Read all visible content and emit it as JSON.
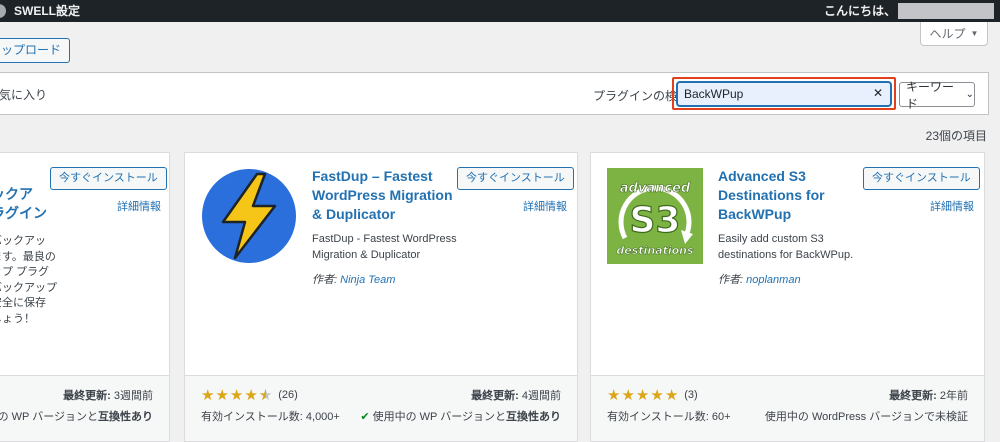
{
  "admin_bar": {
    "site_name": "SWELL設定",
    "greeting": "こんにちは、"
  },
  "help": {
    "label": "ヘルプ"
  },
  "upload": {
    "label": "ップロード"
  },
  "filter": {
    "tab_favorites": "気に入り",
    "search_label": "プラグインの検索",
    "search_value": "BackWPup",
    "search_type": "キーワード"
  },
  "results": {
    "count": "23個の項目"
  },
  "cards": [
    {
      "title_lines": [
        "ックア",
        "ラグイン"
      ],
      "install_label": "今すぐインストール",
      "more_label": "詳細情報",
      "desc_lines": [
        "バックアッ",
        "ます。最良の",
        "ップ プラグ",
        "バックアップ",
        "安全に保存",
        "しょう！"
      ],
      "updated_label": "最終更新:",
      "updated_value": "3週間前",
      "compat_prefix": "用中の WP バージョンと",
      "compat_bold": "互換性あり"
    },
    {
      "title": "FastDup – Fastest WordPress Migration & Duplicator",
      "install_label": "今すぐインストール",
      "more_label": "詳細情報",
      "description": "FastDup - Fastest WordPress Migration & Duplicator",
      "author_label": "作者:",
      "author_name": "Ninja Team",
      "rating": 4.5,
      "rating_count": "(26)",
      "updated_label": "最終更新:",
      "updated_value": "4週間前",
      "installs": "有効インストール数: 4,000+",
      "compat_prefix": "使用中の WP バージョンと",
      "compat_bold": "互換性あり",
      "icon": "lightning-bolt-icon",
      "icon_colors": {
        "bg": "#2a6fdc",
        "bolt": "#f5c518"
      }
    },
    {
      "title": "Advanced S3 Destinations for BackWPup",
      "install_label": "今すぐインストール",
      "more_label": "詳細情報",
      "description": "Easily add custom S3 destinations for BackWPup.",
      "author_label": "作者:",
      "author_name": "noplanman",
      "rating": 5,
      "rating_count": "(3)",
      "updated_label": "最終更新:",
      "updated_value": "2年前",
      "installs": "有効インストール数: 60+",
      "compat_text": "使用中の WordPress バージョンで未検証",
      "icon_text": {
        "top": "advanced",
        "middle": "S3",
        "bottom": "destinations"
      },
      "icon_colors": {
        "bg": "#7cb342"
      }
    }
  ],
  "colors": {
    "accent": "#2271b1",
    "highlight": "#e2401c",
    "star": "#dba617"
  }
}
